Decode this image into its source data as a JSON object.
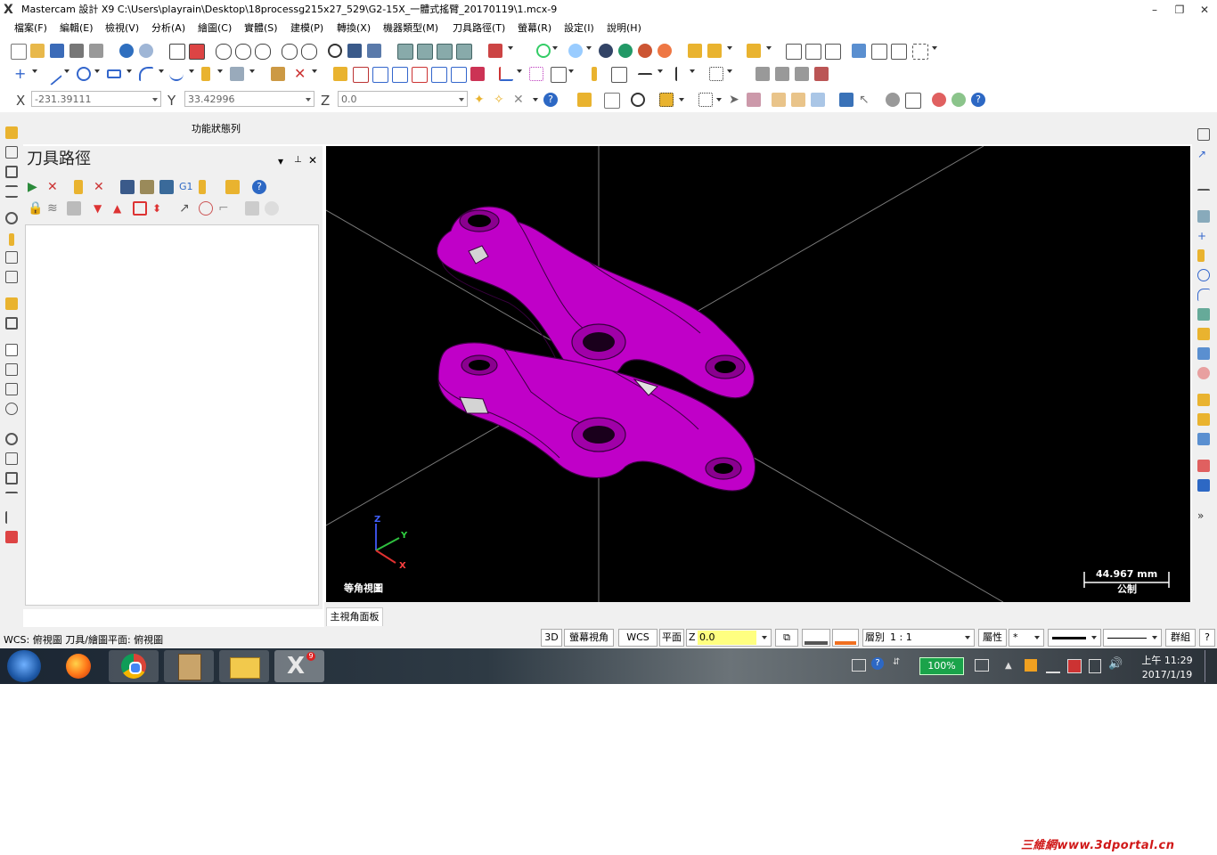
{
  "window": {
    "title": "Mastercam 設計 X9  C:\\Users\\playrain\\Desktop\\18processg215x27_529\\G2-15X_一體式搖臂_20170119\\1.mcx-9",
    "minimize": "–",
    "maximize": "❐",
    "close": "✕"
  },
  "menu": [
    "檔案(F)",
    "編輯(E)",
    "檢視(V)",
    "分析(A)",
    "繪圖(C)",
    "實體(S)",
    "建模(P)",
    "轉換(X)",
    "機器類型(M)",
    "刀具路徑(T)",
    "螢幕(R)",
    "設定(I)",
    "說明(H)"
  ],
  "coords": {
    "x_label": "X",
    "x_value": "-231.39111",
    "y_label": "Y",
    "y_value": "33.42996",
    "z_label": "Z",
    "z_value": "0.0"
  },
  "function_status_label": "功能狀態列",
  "panel": {
    "title": "刀具路徑",
    "pin": "📌",
    "close": "✕",
    "collapse": "▾"
  },
  "viewport": {
    "view_name": "等角視圖",
    "scale_value": "44.967 mm",
    "scale_unit": "公制",
    "axis_z": "Z",
    "axis_y": "Y",
    "axis_x": "X",
    "tab": "主視角面板",
    "background": "#000000",
    "part_color": "#c000c8"
  },
  "status": {
    "wcs_text": "WCS: 俯視圖  刀具/繪圖平面: 俯視圖",
    "btn_3d": "3D",
    "btn_screen_view": "螢幕視角",
    "btn_wcs": "WCS",
    "btn_plane": "平面",
    "z_label": "Z",
    "z_value": "0.0",
    "level_label": "層別",
    "level_value": "1 : 1",
    "attr_label": "屬性",
    "point_style": "*",
    "group_label": "群組",
    "help": "?"
  },
  "taskbar": {
    "battery": "100%",
    "time": "上午 11:29",
    "date": "2017/1/19"
  },
  "watermark": "三維網www.3dportal.cn"
}
